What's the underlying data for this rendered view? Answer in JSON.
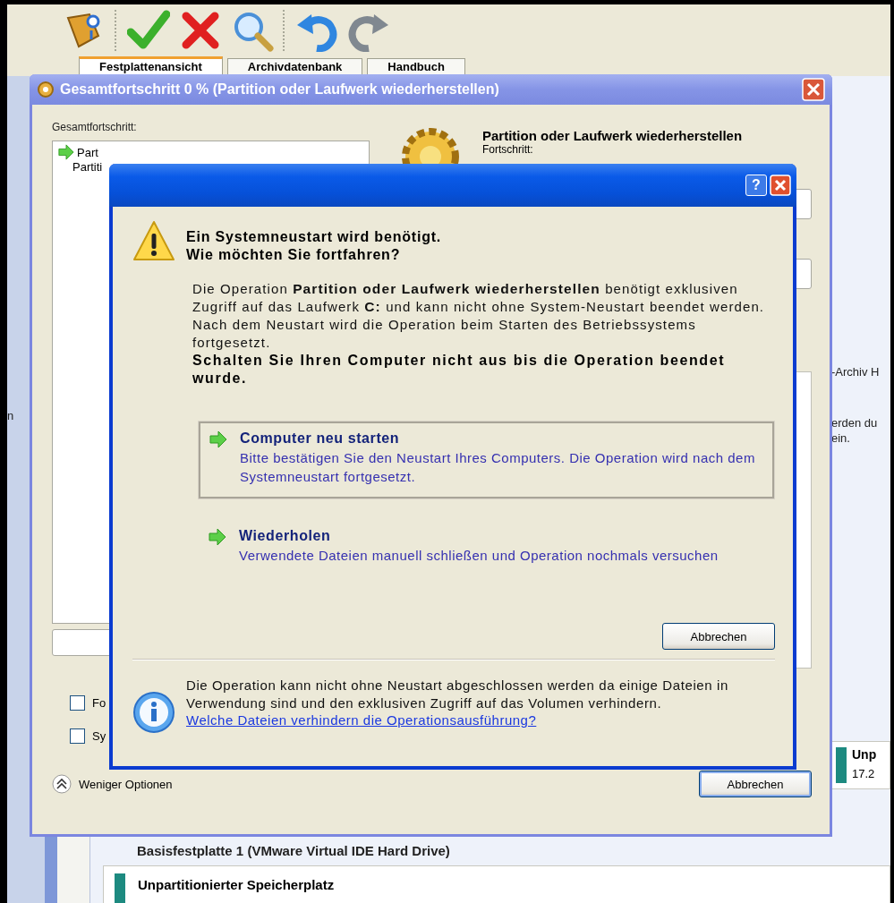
{
  "toolbar": {
    "icons": [
      {
        "kind": "wizard"
      },
      {
        "kind": "apply"
      },
      {
        "kind": "discard"
      },
      {
        "kind": "search"
      },
      {
        "kind": "undo"
      },
      {
        "kind": "redo"
      }
    ]
  },
  "tabs": [
    {
      "label": "Festplattenansicht",
      "selected": true
    },
    {
      "label": "Archivdatenbank",
      "selected": false
    },
    {
      "label": "Handbuch",
      "selected": false
    }
  ],
  "sidebar": {
    "text": "n"
  },
  "background": {
    "notes": [
      "-Archiv H",
      "erden du",
      "ein."
    ],
    "side_partition": {
      "name": "Unp",
      "size": "17.2"
    },
    "disk_label": "Basisfestplatte 1 (VMware Virtual IDE Hard Drive)",
    "partition": {
      "name": "Unpartitionierter Speicherplatz"
    }
  },
  "progress_window": {
    "title": "Gesamtfortschritt 0 % (Partition oder Laufwerk wiederherstellen)",
    "overall_label": "Gesamtfortschritt:",
    "steps": [
      {
        "label": "Part",
        "current": true
      },
      {
        "label": "Partiti",
        "current": false
      }
    ],
    "operation_title": "Partition oder Laufwerk wiederherstellen",
    "progress_label": "Fortschritt:",
    "bars": [
      {
        "level": 0
      },
      {
        "level": 0
      }
    ],
    "options": [
      {
        "label": "Fo",
        "checked": false
      },
      {
        "label": "Sy",
        "checked": false
      }
    ],
    "toggle": "Weniger Optionen",
    "cancel": "Abbrechen"
  },
  "dialog": {
    "help_button": "?",
    "heading": [
      "Ein Systemneustart wird benötigt.",
      "Wie möchten Sie fortfahren?"
    ],
    "body": "Die Operation **Partition oder Laufwerk wiederherstellen** benötigt exklusiven Zugriff auf das Laufwerk **C:** und kann nicht ohne System-Neustart beendet werden. Nach dem Neustart wird die Operation beim Starten des Betriebssystems fortgesetzt.",
    "warning": "Schalten Sie Ihren Computer nicht aus bis die Operation beendet wurde.",
    "choices": [
      {
        "title": "Computer neu starten",
        "description": "Bitte bestätigen Sie den Neustart Ihres Computers. Die Operation wird nach dem Systemneustart fortgesetzt.",
        "selected": true
      },
      {
        "title": "Wiederholen",
        "description": "Verwendete Dateien manuell schließen und Operation nochmals versuchen",
        "selected": false
      }
    ],
    "cancel": "Abbrechen",
    "info": "Die Operation kann nicht ohne Neustart abgeschlossen werden da einige Dateien in Verwendung sind und den exklusiven Zugriff auf das Volumen verhindern.",
    "link": "Welche Dateien verhindern die Operationsausführung?"
  }
}
